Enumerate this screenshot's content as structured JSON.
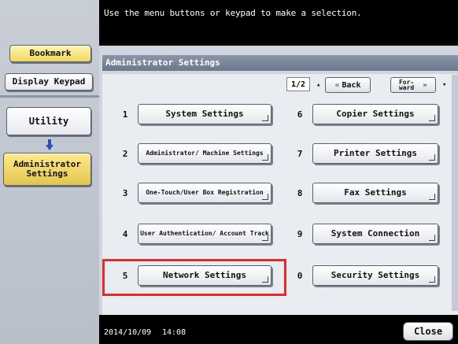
{
  "top_message": "Use the menu buttons or keypad to make a selection.",
  "left": {
    "bookmark": "Bookmark",
    "display_keypad": "Display Keypad",
    "utility": "Utility",
    "admin_settings": "Administrator Settings"
  },
  "window_title": "Administrator Settings",
  "pager": {
    "page": "1/2",
    "back": "Back",
    "forward": "For- ward"
  },
  "menu": [
    {
      "num": "1",
      "label": "System Settings"
    },
    {
      "num": "2",
      "label": "Administrator/ Machine Settings"
    },
    {
      "num": "3",
      "label": "One-Touch/User Box Registration"
    },
    {
      "num": "4",
      "label": "User Authentication/ Account Track"
    },
    {
      "num": "5",
      "label": "Network Settings"
    },
    {
      "num": "6",
      "label": "Copier Settings"
    },
    {
      "num": "7",
      "label": "Printer Settings"
    },
    {
      "num": "8",
      "label": "Fax Settings"
    },
    {
      "num": "9",
      "label": "System Connection"
    },
    {
      "num": "0",
      "label": "Security Settings"
    }
  ],
  "status": {
    "date": "2014/10/09",
    "time": "14:08",
    "close": "Close"
  },
  "colors": {
    "highlight": "#e22b2b",
    "title_bar": "#7a869a",
    "selected_left": "#f0d860"
  }
}
